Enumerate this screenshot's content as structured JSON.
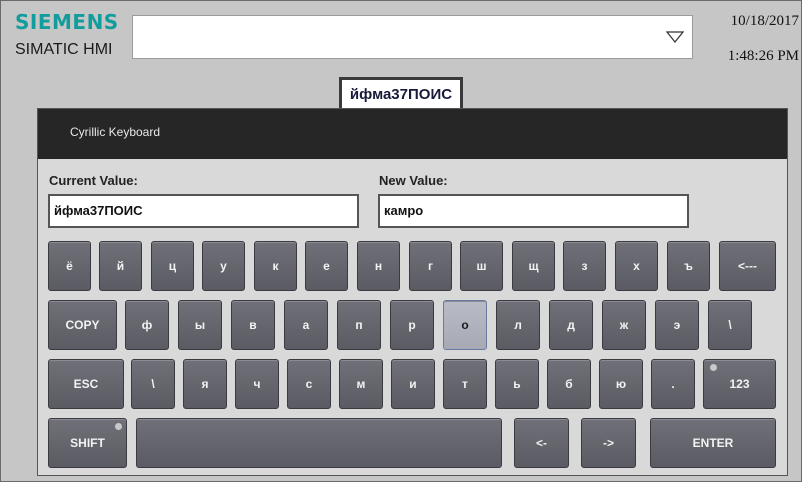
{
  "header": {
    "brand": "SIEMENS",
    "product": "SIMATIC HMI",
    "date": "10/18/2017",
    "time": "1:48:26 PM",
    "accent_color": "#139c9c"
  },
  "dropdown": {
    "value": "",
    "icon": "triangle-down-icon"
  },
  "value_tab": "йфма37ПОИС",
  "keyboard": {
    "title": "Cyrillic Keyboard",
    "current_label": "Current Value:",
    "current_value": "йфма37ПОИС",
    "new_label": "New Value:",
    "new_value": "камро",
    "rows": [
      {
        "keys": [
          "ё",
          "й",
          "ц",
          "у",
          "к",
          "е",
          "н",
          "г",
          "ш",
          "щ",
          "з",
          "х",
          "ъ",
          "<---"
        ]
      },
      {
        "keys": [
          "COPY",
          "ф",
          "ы",
          "в",
          "а",
          "п",
          "р",
          "о",
          "л",
          "д",
          "ж",
          "э",
          "\\"
        ]
      },
      {
        "keys": [
          "ESC",
          "\\",
          "я",
          "ч",
          "с",
          "м",
          "и",
          "т",
          "ь",
          "б",
          "ю",
          ".",
          "123"
        ]
      },
      {
        "keys": [
          "SHIFT",
          "",
          "<-",
          "->",
          "ENTER"
        ]
      }
    ]
  }
}
